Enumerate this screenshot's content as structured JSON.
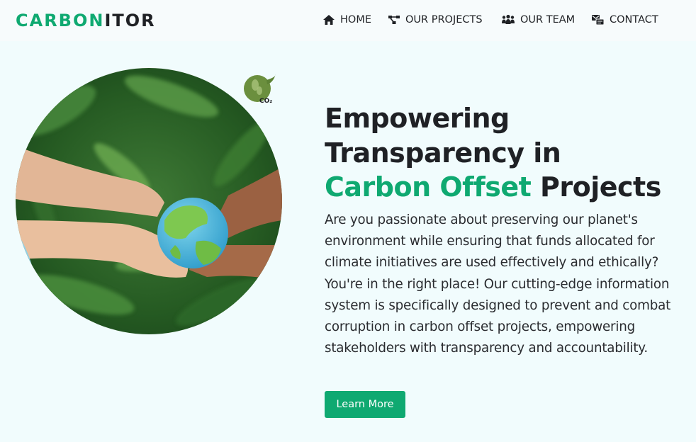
{
  "brand": {
    "part1": "CARBON",
    "part2": "ITOR"
  },
  "nav": {
    "items": [
      {
        "label": "HOME",
        "icon": "home-icon"
      },
      {
        "label": "OUR PROJECTS",
        "icon": "projects-icon"
      },
      {
        "label": "OUR TEAM",
        "icon": "team-icon"
      },
      {
        "label": "CONTACT",
        "icon": "contact-icon"
      }
    ]
  },
  "hero": {
    "headline_line1": "Empowering",
    "headline_line2": "Transparency in",
    "headline_accent": "Carbon Offset",
    "headline_end": "Projects",
    "description": "Are you passionate about preserving our planet's environment while ensuring that funds allocated for climate initiatives are used effectively and ethically? You're in the right place! Our cutting-edge information system is specifically designed to prevent and combat corruption in carbon offset projects, empowering stakeholders with transparency and accountability.",
    "cta_label": "Learn More",
    "badge_text": "CO₂"
  },
  "colors": {
    "accent": "#0fa971",
    "text": "#1f2125",
    "background": "#f1fcfd"
  }
}
